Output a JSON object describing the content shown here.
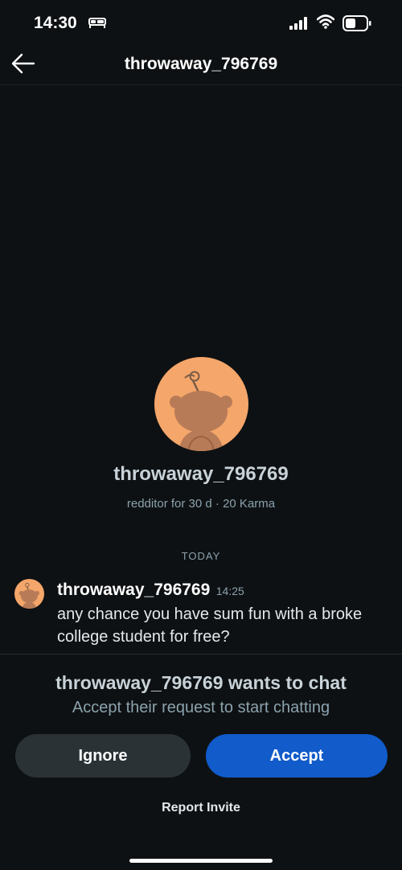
{
  "status_bar": {
    "time": "14:30",
    "icons": [
      "bed-icon",
      "signal-icon",
      "wifi-icon",
      "battery-icon"
    ],
    "battery_level": 0.5
  },
  "nav": {
    "title": "throwaway_796769",
    "back_icon": "arrow-left-icon"
  },
  "profile": {
    "username": "throwaway_796769",
    "meta": "redditor for 30 d · 20 Karma",
    "avatar_color": "#f5a66a"
  },
  "conversation": {
    "date_divider": "TODAY",
    "messages": [
      {
        "author": "throwaway_796769",
        "time": "14:25",
        "text": "any chance you have sum fun with a broke college student for free?"
      }
    ]
  },
  "chat_request": {
    "title": "throwaway_796769 wants to chat",
    "subtitle": "Accept their request to start chatting",
    "ignore_label": "Ignore",
    "accept_label": "Accept",
    "report_label": "Report Invite"
  },
  "colors": {
    "background": "#0e1113",
    "accent": "#115bca",
    "secondary_button": "#2a3236",
    "muted_text": "#8ba2ad"
  }
}
